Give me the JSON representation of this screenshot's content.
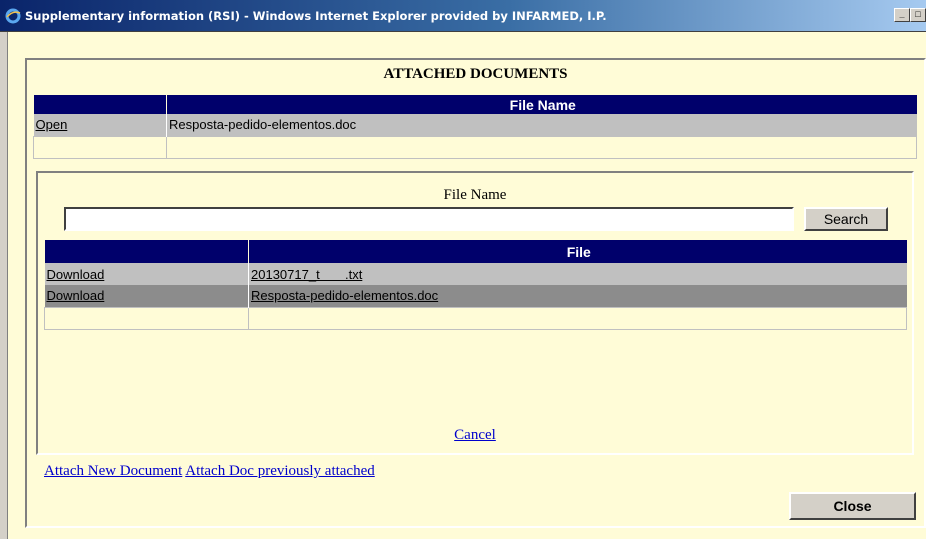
{
  "window": {
    "title": "Supplementary information (RSI) - Windows Internet Explorer provided by INFARMED, I.P.",
    "controls": [
      "_",
      "□"
    ]
  },
  "attached": {
    "heading": "ATTACHED DOCUMENTS",
    "columns": [
      "",
      "File Name"
    ],
    "rows": [
      {
        "action": "Open",
        "file": "Resposta-pedido-elementos.doc"
      }
    ]
  },
  "search": {
    "label": "File Name",
    "value": "",
    "button": "Search"
  },
  "results": {
    "columns": [
      "",
      "File"
    ],
    "rows": [
      {
        "action": "Download",
        "file": "20130717_t       .txt"
      },
      {
        "action": "Download",
        "file": "Resposta-pedido-elementos.doc"
      }
    ]
  },
  "cancel_label": "Cancel",
  "links": {
    "attach_new": "Attach New Document",
    "attach_previous": "Attach Doc previously attached"
  },
  "close_label": "Close"
}
